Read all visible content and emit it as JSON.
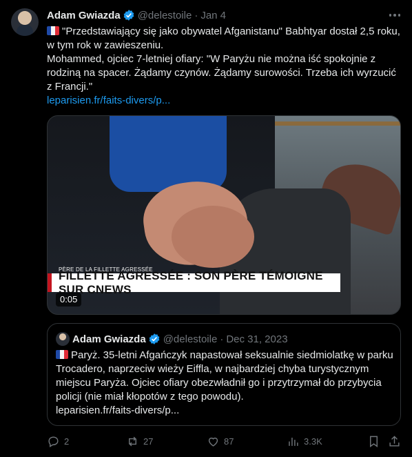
{
  "tweet": {
    "author": {
      "name": "Adam Gwiazda",
      "handle": "@delestoile",
      "separator": "·",
      "date": "Jan 4"
    },
    "text": {
      "line1": "\"Przedstawiający się jako obywatel Afganistanu\" Babhtyar dostał 2,5 roku, w tym rok w zawieszeniu.",
      "line2": "Mohammed, ojciec 7-letniej ofiary: \"W Paryżu nie można iść spokojnie z rodziną na spacer. Żądamy czynów. Żądamy surowości. Trzeba ich wyrzucić z Francji.\"",
      "link": "leparisien.fr/faits-divers/p..."
    },
    "media": {
      "caption_small": "PÈRE DE LA FILLETTE AGRESSÉE",
      "caption_bar": "FILLETTE AGRESSÉE : SON PÈRE TÉMOIGNE SUR CNEWS",
      "timecode": "0:05"
    },
    "quoted": {
      "name": "Adam Gwiazda",
      "handle": "@delestoile",
      "separator": "·",
      "date": "Dec 31, 2023",
      "text": "Paryż. 35-letni Afgańczyk napastował seksualnie siedmiolatkę w parku Trocadero, naprzeciw wieży Eiffla, w najbardziej chyba turystycznym miejscu Paryża. Ojciec ofiary obezwładnił go i przytrzymał do przybycia policji (nie miał kłopotów z tego powodu).",
      "link": "leparisien.fr/faits-divers/p..."
    },
    "actions": {
      "replies": "2",
      "reposts": "27",
      "likes": "87",
      "views": "3.3K"
    }
  },
  "colors": {
    "background": "#000000",
    "text": "#e7e9ea",
    "muted": "#71767b",
    "link": "#1d9bf0",
    "border": "#2f3336"
  },
  "icons": [
    "verified-badge-icon",
    "more-icon",
    "france-flag-icon",
    "reply-icon",
    "repost-icon",
    "like-icon",
    "views-icon",
    "bookmark-icon",
    "share-icon"
  ]
}
